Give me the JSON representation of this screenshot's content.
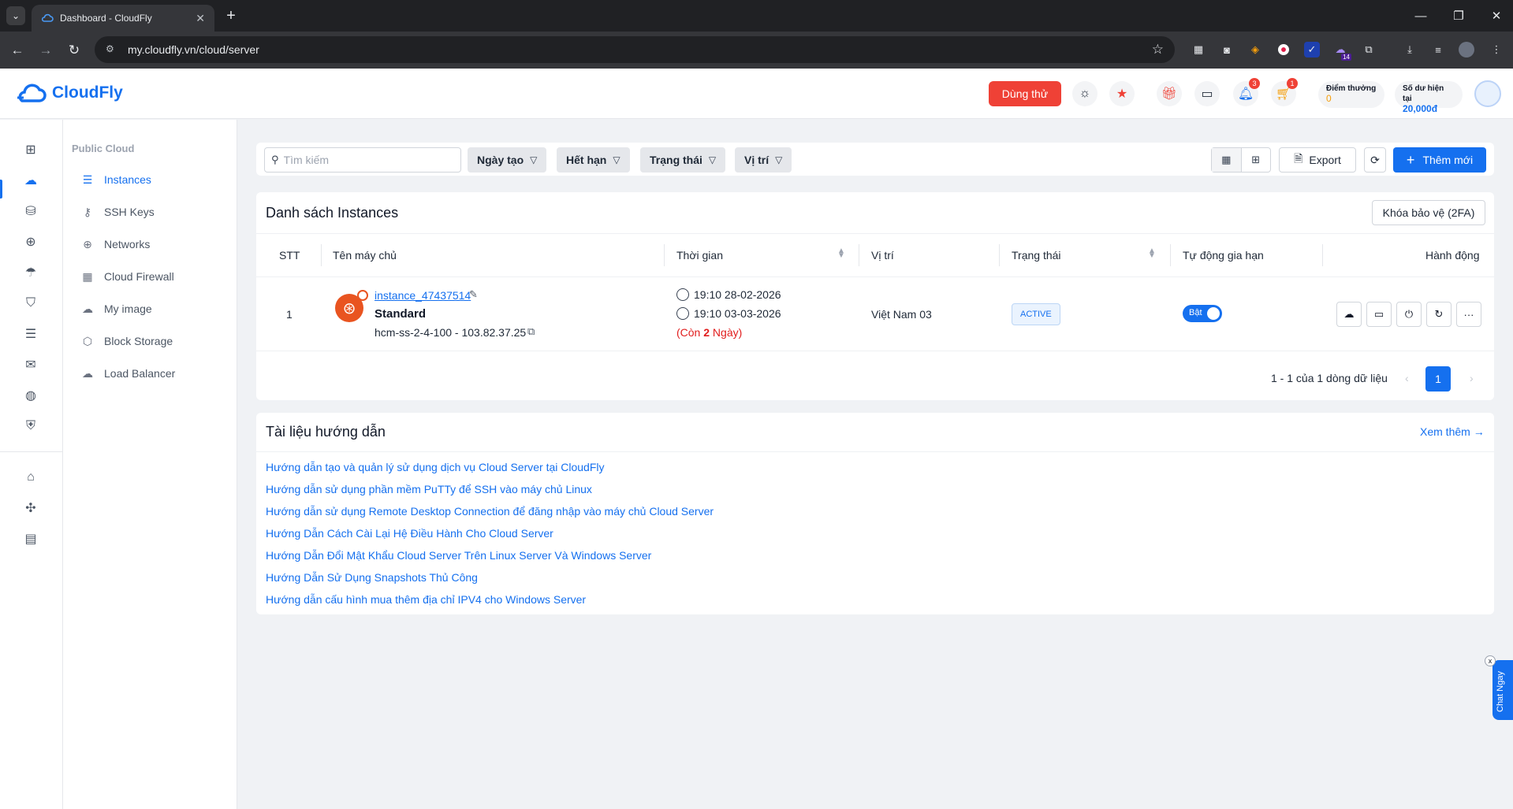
{
  "browser": {
    "tab_title": "Dashboard - CloudFly",
    "url": "my.cloudfly.vn/cloud/server",
    "extension_badge": "14"
  },
  "header": {
    "logo_text": "CloudFly",
    "trial_label": "Dùng thử",
    "notification_count": "3",
    "cart_count": "1",
    "points_label": "Điểm thưởng",
    "points_value": "0",
    "balance_label": "Số dư hiện tại",
    "balance_value": "20,000đ"
  },
  "sidebar": {
    "section_title": "Public Cloud",
    "items": [
      {
        "label": "Instances",
        "icon": "server-icon"
      },
      {
        "label": "SSH Keys",
        "icon": "key-icon"
      },
      {
        "label": "Networks",
        "icon": "network-icon"
      },
      {
        "label": "Cloud Firewall",
        "icon": "firewall-icon"
      },
      {
        "label": "My image",
        "icon": "cloud-upload-icon"
      },
      {
        "label": "Block Storage",
        "icon": "cube-icon"
      },
      {
        "label": "Load Balancer",
        "icon": "balancer-icon"
      }
    ]
  },
  "toolbar": {
    "search_placeholder": "Tìm kiếm",
    "filters": [
      "Ngày tạo",
      "Hết hạn",
      "Trạng thái",
      "Vị trí"
    ],
    "export_label": "Export",
    "add_label": "Thêm mới"
  },
  "instances": {
    "title": "Danh sách Instances",
    "lock_label": "Khóa bảo vệ (2FA)",
    "columns": [
      "STT",
      "Tên máy chủ",
      "Thời gian",
      "Vị trí",
      "Trạng thái",
      "Tự động gia hạn",
      "Hành động"
    ],
    "rows": [
      {
        "stt": "1",
        "name": "instance_47437514",
        "plan": "Standard",
        "host": "hcm-ss-2-4-100 - 103.82.37.25",
        "created": "19:10 28-02-2026",
        "expires": "19:10 03-03-2026",
        "remaining_prefix": "(Còn ",
        "remaining_days": "2",
        "remaining_suffix": " Ngày)",
        "location": "Việt Nam 03",
        "status": "ACTIVE",
        "auto_renew_label": "Bật",
        "auto_renew": true
      }
    ],
    "pagination_text": "1 - 1 của 1 dòng dữ liệu",
    "current_page": "1"
  },
  "docs": {
    "title": "Tài liệu hướng dẫn",
    "see_more": "Xem thêm",
    "links": [
      "Hướng dẫn tạo và quản lý sử dụng dịch vụ Cloud Server tại CloudFly",
      "Hướng dẫn sử dụng phần mềm PuTTy để SSH vào máy chủ Linux",
      "Hướng dẫn sử dụng Remote Desktop Connection để đăng nhập vào máy chủ Cloud Server",
      "Hướng Dẫn Cách Cài Lại Hệ Điều Hành Cho Cloud Server",
      "Hướng Dẫn Đổi Mật Khẩu Cloud Server Trên Linux Server Và Windows Server",
      "Hướng Dẫn Sử Dụng Snapshots Thủ Công",
      "Hướng dẫn cấu hình mua thêm địa chỉ IPV4 cho Windows Server"
    ]
  },
  "chat": {
    "label": "Chat Ngay",
    "close": "x"
  },
  "colors": {
    "primary": "#1570ef",
    "danger": "#ef4136",
    "remaining": "#e11d1d"
  }
}
